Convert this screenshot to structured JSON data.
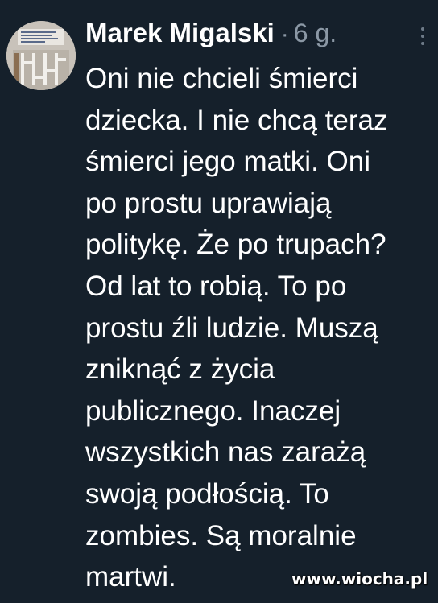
{
  "tweet": {
    "author_name": "Marek Migalski",
    "separator": "·",
    "timestamp": "6 g.",
    "more_icon": "more-vertical-icon",
    "text_lines": [
      "Oni nie chcieli śmierci",
      "dziecka. I nie chcą teraz",
      "śmierci jego matki. Oni",
      "po prostu uprawiają",
      "politykę. Że po trupach?",
      "Od lat to robią. To po",
      "prostu źli ludzie. Muszą",
      "zniknąć z życia",
      "publicznego. Inaczej",
      "wszystkich nas zarażą",
      "swoją podłością. To",
      "zombies. Są moralnie",
      "martwi."
    ]
  },
  "watermark": {
    "text": "www.wiocha.pl"
  },
  "colors": {
    "background": "#15202b",
    "text": "#ffffff",
    "muted": "#8b98a5"
  }
}
